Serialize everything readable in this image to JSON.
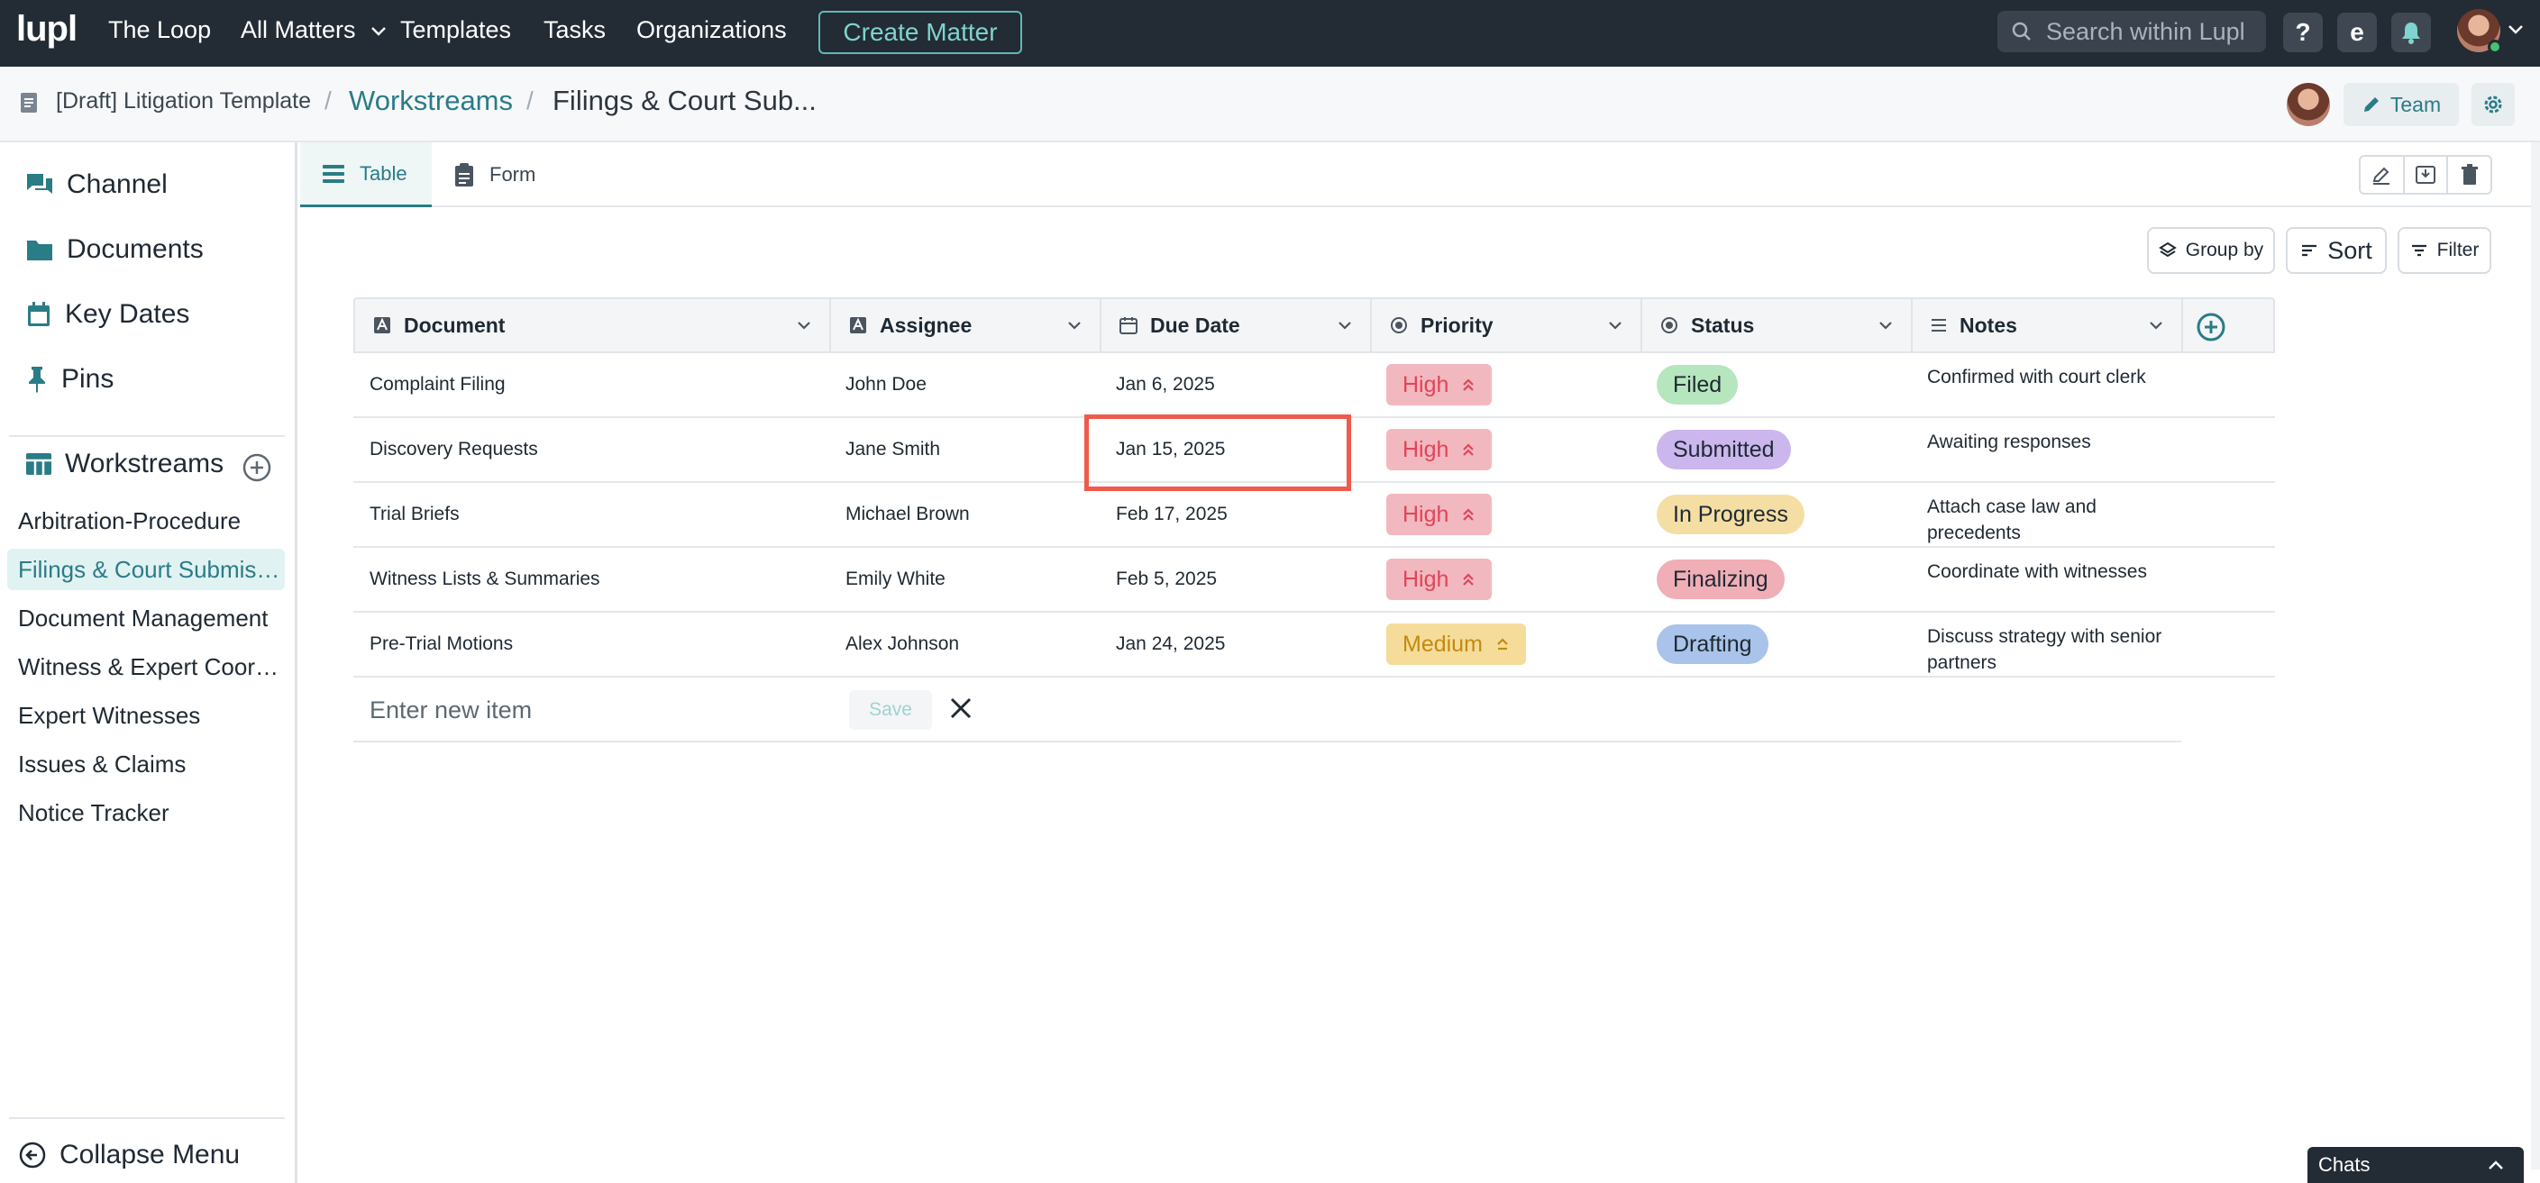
{
  "nav": {
    "logo": "lupl",
    "links": [
      "The Loop",
      "All Matters",
      "Templates",
      "Tasks",
      "Organizations"
    ],
    "create_button": "Create Matter",
    "search_placeholder": "Search within Lupl",
    "help_label": "?",
    "e_label": "e"
  },
  "breadcrumb": {
    "template": "[Draft] Litigation Template",
    "workstreams": "Workstreams",
    "current": "Filings & Court Sub...",
    "team_button": "Team"
  },
  "sidebar": {
    "main": [
      {
        "label": "Channel",
        "icon": "chat-icon"
      },
      {
        "label": "Documents",
        "icon": "folder-icon"
      },
      {
        "label": "Key Dates",
        "icon": "calendar-icon"
      },
      {
        "label": "Pins",
        "icon": "pin-icon"
      }
    ],
    "workstreams_label": "Workstreams",
    "workstreams": [
      "Arbitration-Procedure",
      "Filings & Court Submissions",
      "Document Management",
      "Witness & Expert Coordination",
      "Expert Witnesses",
      "Issues & Claims",
      "Notice Tracker"
    ],
    "active_index": 1,
    "collapse_label": "Collapse Menu"
  },
  "tabs": [
    {
      "label": "Table",
      "active": true
    },
    {
      "label": "Form",
      "active": false
    }
  ],
  "controls": {
    "group_by": "Group by",
    "sort": "Sort",
    "filter": "Filter"
  },
  "table": {
    "columns": [
      "Document",
      "Assignee",
      "Due Date",
      "Priority",
      "Status",
      "Notes"
    ],
    "rows": [
      {
        "document": "Complaint Filing",
        "assignee": "John Doe",
        "due": "Jan 6, 2025",
        "priority": "High",
        "status": "Filed",
        "notes": "Confirmed with court clerk"
      },
      {
        "document": "Discovery Requests",
        "assignee": "Jane Smith",
        "due": "Jan 15, 2025",
        "priority": "High",
        "status": "Submitted",
        "notes": "Awaiting responses"
      },
      {
        "document": "Trial Briefs",
        "assignee": "Michael Brown",
        "due": "Feb 17, 2025",
        "priority": "High",
        "status": "In Progress",
        "notes": "Attach case law and precedents"
      },
      {
        "document": "Witness Lists & Summaries",
        "assignee": "Emily White",
        "due": "Feb 5, 2025",
        "priority": "High",
        "status": "Finalizing",
        "notes": "Coordinate with witnesses"
      },
      {
        "document": "Pre-Trial Motions",
        "assignee": "Alex Johnson",
        "due": "Jan 24, 2025",
        "priority": "Medium",
        "status": "Drafting",
        "notes": "Discuss strategy with senior partners"
      }
    ],
    "new_item_placeholder": "Enter new item",
    "save_label": "Save"
  },
  "colors": {
    "accent": "#2a7c86",
    "priority_high_bg": "#f2b8bf",
    "priority_high_fg": "#e0445a",
    "priority_medium_bg": "#f5dc9a",
    "priority_medium_fg": "#c48a10",
    "status": {
      "Filed": "#b5e6bd",
      "Submitted": "#cbb6ee",
      "In Progress": "#f4dea3",
      "Finalizing": "#f0aeb6",
      "Drafting": "#a9c3ea"
    }
  },
  "chats_label": "Chats"
}
